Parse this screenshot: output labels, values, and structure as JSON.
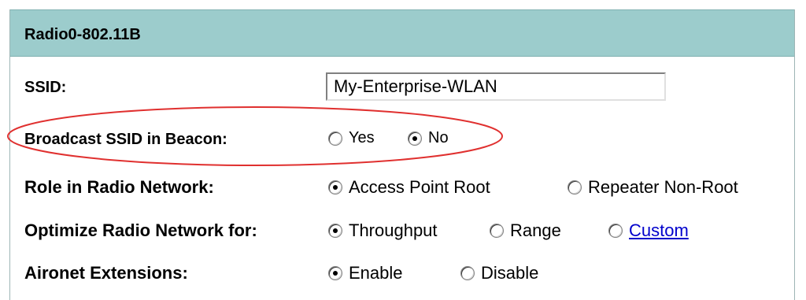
{
  "header": {
    "title": "Radio0-802.11B"
  },
  "ssid": {
    "label": "SSID:",
    "value": "My-Enterprise-WLAN"
  },
  "broadcast": {
    "label": "Broadcast SSID in Beacon:",
    "options": [
      {
        "label": "Yes",
        "selected": false
      },
      {
        "label": "No",
        "selected": true
      }
    ]
  },
  "role": {
    "label": "Role in Radio Network:",
    "options": [
      {
        "label": "Access Point Root",
        "selected": true
      },
      {
        "label": "Repeater Non-Root",
        "selected": false
      }
    ]
  },
  "optimize": {
    "label": "Optimize Radio Network for:",
    "options": [
      {
        "label": "Throughput",
        "selected": true
      },
      {
        "label": "Range",
        "selected": false
      },
      {
        "label": "Custom",
        "selected": false
      }
    ]
  },
  "aironet": {
    "label": "Aironet Extensions:",
    "options": [
      {
        "label": "Enable",
        "selected": true
      },
      {
        "label": "Disable",
        "selected": false
      }
    ]
  },
  "colors": {
    "header_bg": "#9ccccc",
    "annotation": "#e0302f",
    "link": "#0000cc"
  }
}
